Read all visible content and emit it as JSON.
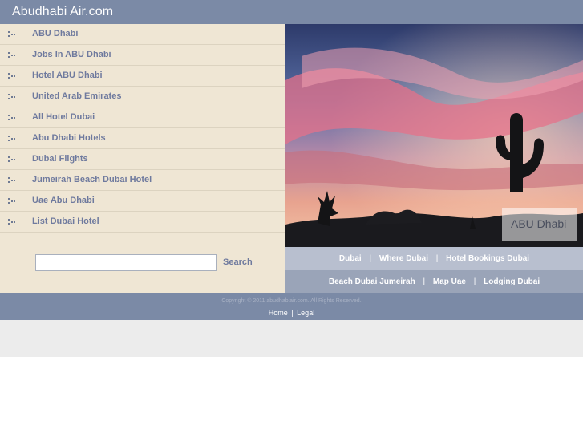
{
  "header": {
    "site_title": "Abudhabi Air.com"
  },
  "sidebar": {
    "nav_items": [
      {
        "label": "ABU Dhabi"
      },
      {
        "label": "Jobs In ABU Dhabi"
      },
      {
        "label": "Hotel ABU Dhabi"
      },
      {
        "label": "United Arab Emirates"
      },
      {
        "label": "All Hotel Dubai"
      },
      {
        "label": "Abu Dhabi Hotels"
      },
      {
        "label": "Dubai Flights"
      },
      {
        "label": "Jumeirah Beach Dubai Hotel"
      },
      {
        "label": "Uae Abu Dhabi"
      },
      {
        "label": "List Dubai Hotel"
      }
    ],
    "bullet_icon": "dotted-bullet-icon",
    "search": {
      "value": "",
      "placeholder": "",
      "button_label": "Search"
    }
  },
  "hero": {
    "caption": "ABU Dhabi",
    "image": "desert-sunset-cactus-photo"
  },
  "quick_links": {
    "row1": [
      {
        "label": "Dubai"
      },
      {
        "label": "Where Dubai"
      },
      {
        "label": "Hotel Bookings Dubai"
      }
    ],
    "row2": [
      {
        "label": "Beach Dubai Jumeirah"
      },
      {
        "label": "Map Uae"
      },
      {
        "label": "Lodging Dubai"
      }
    ],
    "separator": "|"
  },
  "footer": {
    "copyright": "Copyright © 2011 abudhabiair.com. All Rights Reserved.",
    "links": [
      {
        "label": "Home"
      },
      {
        "label": "Legal"
      }
    ],
    "separator": "|"
  },
  "colors": {
    "header_bg": "#7b8aa6",
    "sidebar_bg": "#efe6d4",
    "link_color": "#6f7a9e",
    "links_bar_light": "#b8bfcf",
    "links_bar_dark": "#9aa4b8",
    "bottom_band": "#ececec"
  }
}
